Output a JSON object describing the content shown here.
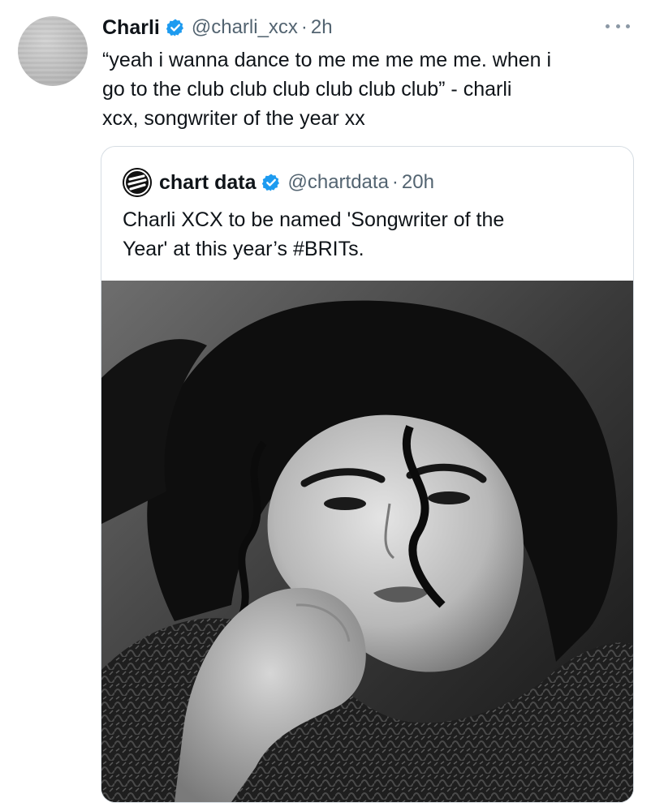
{
  "tweet": {
    "author_name": "Charli",
    "author_handle": "@charli_xcx",
    "separator": "·",
    "time": "2h",
    "text": "“yeah i wanna dance to me me me me me. when i\ngo to the club club club club club club” - charli\nxcx, songwriter of the year xx",
    "verified_icon": "verified-badge-icon",
    "more_icon": "more-options-icon"
  },
  "quoted_tweet": {
    "author_name": "chart data",
    "author_handle": "@chartdata",
    "separator": "·",
    "time": "20h",
    "text": "Charli XCX to be named 'Songwriter of the\nYear' at this year’s #BRITs.",
    "avatar_icon": "chart-data-logo-icon",
    "verified_icon": "verified-badge-icon"
  },
  "colors": {
    "text_primary": "#0f1419",
    "text_secondary": "#536471",
    "verified_blue": "#1d9bf0",
    "border": "#d6dde3"
  }
}
